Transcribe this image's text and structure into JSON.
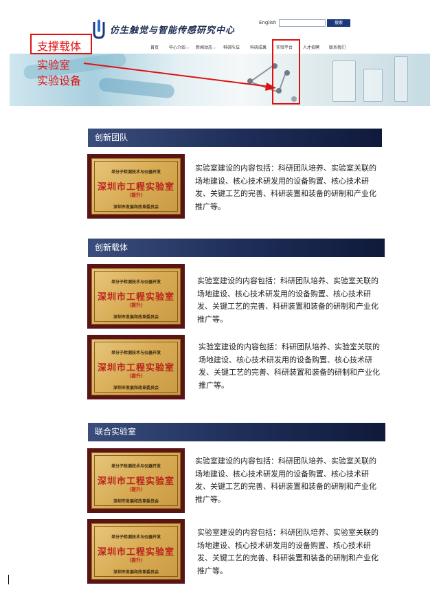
{
  "header": {
    "site_title": "仿生触觉与智能传感研究中心",
    "lang_link": "English",
    "search_placeholder": "",
    "search_button": "搜索",
    "nav": [
      {
        "label": "首页",
        "has_menu": false
      },
      {
        "label": "中心介绍",
        "has_menu": true
      },
      {
        "label": "新闻动态",
        "has_menu": true
      },
      {
        "label": "科研队伍",
        "has_menu": false
      },
      {
        "label": "科研成果",
        "has_menu": false
      },
      {
        "label": "实验平台",
        "has_menu": false,
        "active": true
      },
      {
        "label": "人才招聘",
        "has_menu": false
      },
      {
        "label": "联系我们",
        "has_menu": false
      }
    ]
  },
  "annotation": {
    "line1": "支撑载体",
    "line2": "实验室",
    "line3": "实验设备",
    "color": "#e01010"
  },
  "certificate": {
    "top": "单分子检测技术与仪器开发",
    "main": "深圳市工程实验室",
    "sub": "（提升）",
    "issuer": "深圳市发展和改革委员会"
  },
  "description": "实验室建设的内容包括：科研团队培养、实验室关联的场地建设、核心技术研发用的设备购置、核心技术研发、关键工艺的完善、科研装置和装备的研制和产业化推广等。",
  "sections": [
    {
      "title": "创新团队",
      "item_count": 1
    },
    {
      "title": "创新载体",
      "item_count": 2
    },
    {
      "title": "联合实验室",
      "item_count": 2
    }
  ],
  "colors": {
    "section_header": "#1f2f5a",
    "nav_active_border": "#e01010",
    "cert_frame": "#5a1414",
    "cert_text": "#b8221c"
  }
}
